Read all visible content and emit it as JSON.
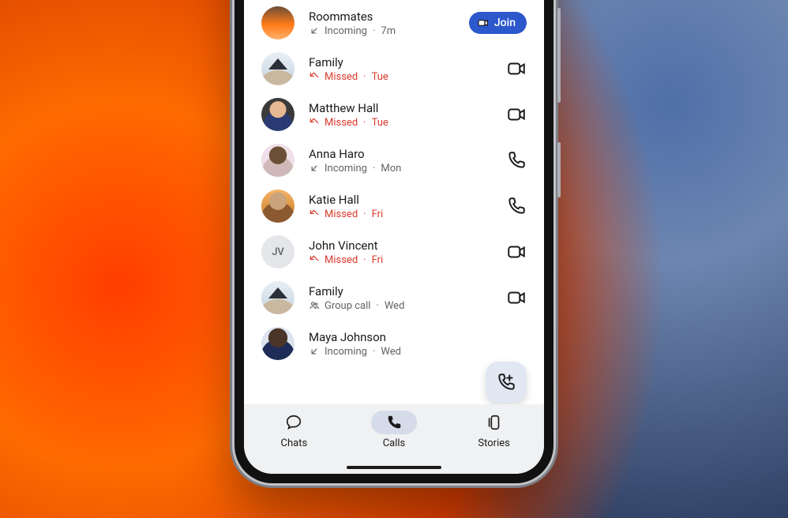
{
  "join_label": "Join",
  "calls": [
    {
      "name": "Roommates",
      "status": "incoming",
      "status_label": "Incoming",
      "time": "7m",
      "action": "join",
      "avatar": "av-sunset"
    },
    {
      "name": "Family",
      "status": "missed",
      "status_label": "Missed",
      "time": "Tue",
      "action": "video",
      "avatar": "av-house"
    },
    {
      "name": "Matthew Hall",
      "status": "missed",
      "status_label": "Missed",
      "time": "Tue",
      "action": "video",
      "avatar": "av-man"
    },
    {
      "name": "Anna Haro",
      "status": "incoming",
      "status_label": "Incoming",
      "time": "Mon",
      "action": "audio",
      "avatar": "av-woman1"
    },
    {
      "name": "Katie Hall",
      "status": "missed",
      "status_label": "Missed",
      "time": "Fri",
      "action": "audio",
      "avatar": "av-woman2"
    },
    {
      "name": "John Vincent",
      "status": "missed",
      "status_label": "Missed",
      "time": "Fri",
      "action": "video",
      "avatar": "av-initials",
      "initials": "JV"
    },
    {
      "name": "Family",
      "status": "group",
      "status_label": "Group call",
      "time": "Wed",
      "action": "video",
      "avatar": "av-house"
    },
    {
      "name": "Maya Johnson",
      "status": "incoming",
      "status_label": "Incoming",
      "time": "Wed",
      "action": "none",
      "avatar": "av-woman3"
    }
  ],
  "nav": {
    "chats": "Chats",
    "calls": "Calls",
    "stories": "Stories"
  }
}
